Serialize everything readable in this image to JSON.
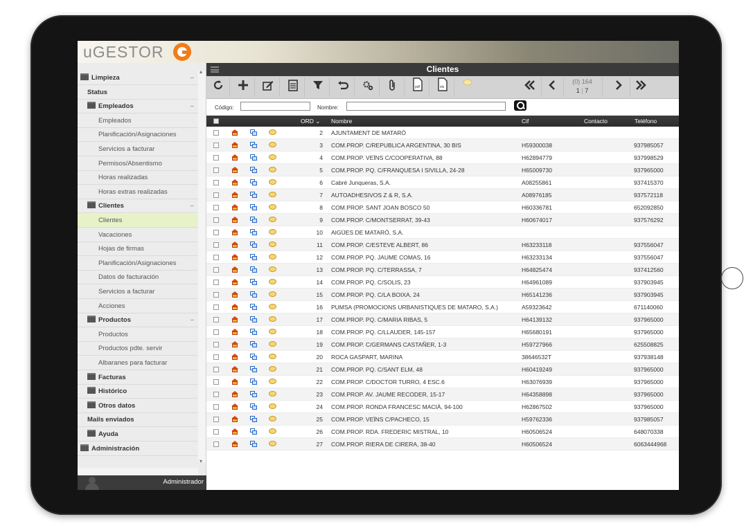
{
  "app": {
    "logo_text": "uGESTOR",
    "brand_color": "#f07d1a"
  },
  "sidebar": {
    "items": [
      {
        "label": "Limpieza",
        "level": 0,
        "folder": true,
        "collapsible": true
      },
      {
        "label": "Status",
        "level": 1,
        "folder": false
      },
      {
        "label": "Empleados",
        "level": 1,
        "folder": true,
        "collapsible": true
      },
      {
        "label": "Empleados",
        "level": 2
      },
      {
        "label": "Planificación/Asignaciones",
        "level": 2
      },
      {
        "label": "Servicios a facturar",
        "level": 2
      },
      {
        "label": "Permisos/Absentismo",
        "level": 2
      },
      {
        "label": "Horas realizadas",
        "level": 2
      },
      {
        "label": "Horas extras realizadas",
        "level": 2
      },
      {
        "label": "Clientes",
        "level": 1,
        "folder": true,
        "collapsible": true
      },
      {
        "label": "Clientes",
        "level": 2,
        "active": true
      },
      {
        "label": "Vacaciones",
        "level": 2
      },
      {
        "label": "Hojas de firmas",
        "level": 2
      },
      {
        "label": "Planificación/Asignaciones",
        "level": 2
      },
      {
        "label": "Datos de facturación",
        "level": 2
      },
      {
        "label": "Servicios a facturar",
        "level": 2
      },
      {
        "label": "Acciones",
        "level": 2
      },
      {
        "label": "Productos",
        "level": 1,
        "folder": true,
        "collapsible": true
      },
      {
        "label": "Productos",
        "level": 2
      },
      {
        "label": "Productos pdte. servir",
        "level": 2
      },
      {
        "label": "Albaranes para facturar",
        "level": 2
      },
      {
        "label": "Facturas",
        "level": 1,
        "folder": true
      },
      {
        "label": "Histórico",
        "level": 1,
        "folder": true
      },
      {
        "label": "Otros datos",
        "level": 1,
        "folder": true
      },
      {
        "label": "Mails enviados",
        "level": 1,
        "folder": false
      },
      {
        "label": "Ayuda",
        "level": 1,
        "folder": true
      },
      {
        "label": "Administración",
        "level": 0,
        "folder": true
      }
    ],
    "collapse_symbol": "–",
    "user": "Administrador"
  },
  "main": {
    "title": "Clientes",
    "toolbar": {
      "icons": [
        "refresh-icon",
        "add-icon",
        "edit-icon",
        "checklist-icon",
        "filter-icon",
        "undo-icon",
        "settings-icon",
        "attach-icon",
        "pdf-icon",
        "xls-icon",
        "comment-icon",
        "first-page-icon",
        "prev-page-icon",
        "next-page-icon",
        "last-page-icon"
      ],
      "pdf_label": "pdf",
      "xls_label": "xls",
      "pager_top": "(0) 164",
      "pager_page": "1",
      "pager_total": "7"
    },
    "filters": {
      "codigo_label": "Código:",
      "codigo_value": "",
      "nombre_label": "Nombre:",
      "nombre_value": ""
    },
    "columns": {
      "ord": "ORD",
      "nombre": "Nombre",
      "cif": "Cif",
      "contacto": "Contacto",
      "telefono": "Teléfono"
    },
    "rows": [
      {
        "ord": "2",
        "nombre": "AJUNTAMENT DE MATARÓ",
        "cif": "",
        "contacto": "",
        "telefono": ""
      },
      {
        "ord": "3",
        "nombre": "COM.PROP. C/REPUBLICA ARGENTINA, 30 BIS",
        "cif": "H59300038",
        "contacto": "",
        "telefono": "937985057"
      },
      {
        "ord": "4",
        "nombre": "COM.PROP. VEÏNS C/COOPERATIVA, 88",
        "cif": "H62894779",
        "contacto": "",
        "telefono": "937998529"
      },
      {
        "ord": "5",
        "nombre": "COM.PROP. PQ. C/FRANQUESA I SIVILLA, 24-28",
        "cif": "H65009730",
        "contacto": "",
        "telefono": "937965000"
      },
      {
        "ord": "6",
        "nombre": "Cabré Junqueras, S.A.",
        "cif": "A08255861",
        "contacto": "",
        "telefono": "937415370"
      },
      {
        "ord": "7",
        "nombre": "AUTOADHESIVOS Z & R, S.A.",
        "cif": "A08976185",
        "contacto": "",
        "telefono": "937572118"
      },
      {
        "ord": "8",
        "nombre": "COM.PROP. SANT JOAN BOSCO 50",
        "cif": "H60336781",
        "contacto": "",
        "telefono": "652092850"
      },
      {
        "ord": "9",
        "nombre": "COM.PROP. C/MONTSERRAT, 39-43",
        "cif": "H60674017",
        "contacto": "",
        "telefono": "937576292"
      },
      {
        "ord": "10",
        "nombre": "AIGÜES DE MATARÓ, S.A.",
        "cif": "",
        "contacto": "",
        "telefono": ""
      },
      {
        "ord": "11",
        "nombre": "COM.PROP. C/ESTEVE ALBERT, 86",
        "cif": "H63233118",
        "contacto": "",
        "telefono": "937556047"
      },
      {
        "ord": "12",
        "nombre": "COM.PROP. PQ. JAUME COMAS, 16",
        "cif": "H63233134",
        "contacto": "",
        "telefono": "937556047"
      },
      {
        "ord": "13",
        "nombre": "COM.PROP. PQ. C/TERRASSA, 7",
        "cif": "H64825474",
        "contacto": "",
        "telefono": "937412560"
      },
      {
        "ord": "14",
        "nombre": "COM.PROP. PQ. C/SOLIS, 23",
        "cif": "H64961089",
        "contacto": "",
        "telefono": "937903945"
      },
      {
        "ord": "15",
        "nombre": "COM.PROP. PQ. C/LA BOIXA, 24",
        "cif": "H65141236",
        "contacto": "",
        "telefono": "937903945"
      },
      {
        "ord": "16",
        "nombre": "PUMSA (PROMOCIONS URBANISTIQUES DE MATARO, S.A.)",
        "cif": "A59323642",
        "contacto": "",
        "telefono": "671140060"
      },
      {
        "ord": "17",
        "nombre": "COM.PROP. PQ. C/MARIA RIBAS, 5",
        "cif": "H64139132",
        "contacto": "",
        "telefono": "937965000"
      },
      {
        "ord": "18",
        "nombre": "COM.PROP. PQ. C/LLAUDER, 145-157",
        "cif": "H65680191",
        "contacto": "",
        "telefono": "937965000"
      },
      {
        "ord": "19",
        "nombre": "COM.PROP. C/GERMANS CASTAÑER, 1-3",
        "cif": "H59727966",
        "contacto": "",
        "telefono": "625508825"
      },
      {
        "ord": "20",
        "nombre": "ROCA GASPART, MARINA",
        "cif": "38646532T",
        "contacto": "",
        "telefono": "937938148"
      },
      {
        "ord": "21",
        "nombre": "COM.PROP. PQ. C/SANT ELM, 48",
        "cif": "H60419249",
        "contacto": "",
        "telefono": "937965000"
      },
      {
        "ord": "22",
        "nombre": "COM.PROP. C/DOCTOR TURRO, 4 ESC.6",
        "cif": "H63076939",
        "contacto": "",
        "telefono": "937965000"
      },
      {
        "ord": "23",
        "nombre": "COM.PROP. AV. JAUME RECODER, 15-17",
        "cif": "H64358898",
        "contacto": "",
        "telefono": "937965000"
      },
      {
        "ord": "24",
        "nombre": "COM.PROP. RONDA FRANCESC MACIÀ, 94-100",
        "cif": "H62867502",
        "contacto": "",
        "telefono": "937965000"
      },
      {
        "ord": "25",
        "nombre": "COM.PROP. VEÏNS C/PACHECO, 15",
        "cif": "H59762336",
        "contacto": "",
        "telefono": "937985057"
      },
      {
        "ord": "26",
        "nombre": "COM.PROP. RDA. FREDERIC MISTRAL, 10",
        "cif": "H60506524",
        "contacto": "",
        "telefono": "648070338"
      },
      {
        "ord": "27",
        "nombre": "COM.PROP. RIERA DE CIRERA, 38-40",
        "cif": "H60506524",
        "contacto": "",
        "telefono": "6063444968"
      }
    ]
  }
}
